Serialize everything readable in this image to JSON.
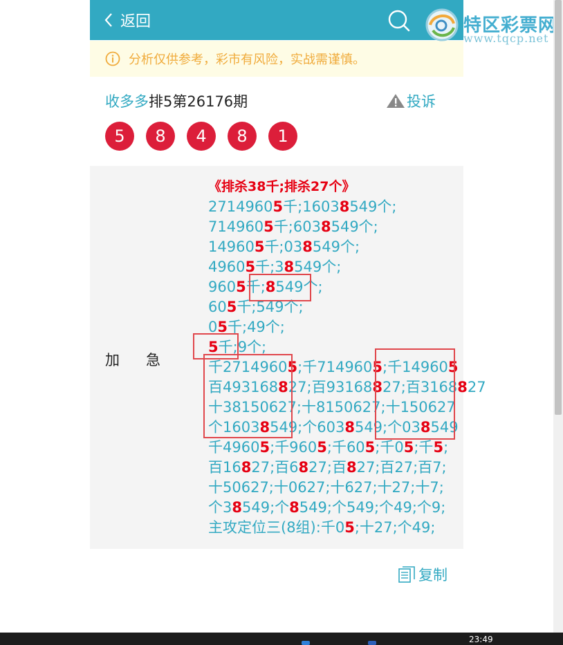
{
  "header": {
    "back_label": "返回"
  },
  "notice": {
    "text": "分析仅供参考，彩市有风险，实战需谨慎。"
  },
  "title": {
    "source": "收多多",
    "issue": "排5第26176期",
    "complain": "投诉"
  },
  "balls": [
    "5",
    "8",
    "4",
    "8",
    "1"
  ],
  "panel": {
    "label": "加急",
    "heading": "《排杀38千;排杀27个》",
    "lines": [
      [
        [
          "2714960",
          0
        ],
        [
          "5",
          1
        ],
        [
          "千;1603",
          0
        ],
        [
          "8",
          1
        ],
        [
          "549个;",
          0
        ]
      ],
      [
        [
          "714960",
          0
        ],
        [
          "5",
          1
        ],
        [
          "千;603",
          0
        ],
        [
          "8",
          1
        ],
        [
          "549个;",
          0
        ]
      ],
      [
        [
          "14960",
          0
        ],
        [
          "5",
          1
        ],
        [
          "千;03",
          0
        ],
        [
          "8",
          1
        ],
        [
          "549个;",
          0
        ]
      ],
      [
        [
          "4960",
          0
        ],
        [
          "5",
          1
        ],
        [
          "千;3",
          0
        ],
        [
          "8",
          1
        ],
        [
          "549个;",
          0
        ]
      ],
      [
        [
          "960",
          0
        ],
        [
          "5",
          1
        ],
        [
          "千;",
          0
        ],
        [
          "8",
          1
        ],
        [
          "549个;",
          0
        ]
      ],
      [
        [
          "60",
          0
        ],
        [
          "5",
          1
        ],
        [
          "千;549个;",
          0
        ]
      ],
      [
        [
          "0",
          0
        ],
        [
          "5",
          1
        ],
        [
          "千;49个;",
          0
        ]
      ],
      [
        [
          "5",
          1
        ],
        [
          "千;9个;",
          0
        ]
      ],
      [
        [
          "千2714960",
          0
        ],
        [
          "5",
          1
        ],
        [
          ";千714960",
          0
        ],
        [
          "5",
          1
        ],
        [
          ";千14960",
          0
        ],
        [
          "5",
          1
        ]
      ],
      [
        [
          "百493168",
          0
        ],
        [
          "8",
          1
        ],
        [
          "27;百93168",
          0
        ],
        [
          "8",
          1
        ],
        [
          "27;百3168",
          0
        ],
        [
          "8",
          1
        ],
        [
          "27",
          0
        ]
      ],
      [
        [
          "十38150627;十8150627;十150627",
          0
        ]
      ],
      [
        [
          "个1603",
          0
        ],
        [
          "8",
          1
        ],
        [
          "549;个603",
          0
        ],
        [
          "8",
          1
        ],
        [
          "549;个03",
          0
        ],
        [
          "8",
          1
        ],
        [
          "549",
          0
        ]
      ],
      [
        [
          "千4960",
          0
        ],
        [
          "5",
          1
        ],
        [
          ";千960",
          0
        ],
        [
          "5",
          1
        ],
        [
          ";千60",
          0
        ],
        [
          "5",
          1
        ],
        [
          ";千0",
          0
        ],
        [
          "5",
          1
        ],
        [
          ";千",
          0
        ],
        [
          "5",
          1
        ],
        [
          ";",
          0
        ]
      ],
      [
        [
          "百16",
          0
        ],
        [
          "8",
          1
        ],
        [
          "27;百6",
          0
        ],
        [
          "8",
          1
        ],
        [
          "27;百",
          0
        ],
        [
          "8",
          1
        ],
        [
          "27;百27;百7;",
          0
        ]
      ],
      [
        [
          "十50627;十0627;十627;十27;十7;",
          0
        ]
      ],
      [
        [
          "个3",
          0
        ],
        [
          "8",
          1
        ],
        [
          "549;个",
          0
        ],
        [
          "8",
          1
        ],
        [
          "549;个549;个49;个9;",
          0
        ]
      ],
      [
        [
          "主攻定位三(8组):千0",
          0
        ],
        [
          "5",
          1
        ],
        [
          ";十27;个49;",
          0
        ]
      ]
    ],
    "copy_label": "复制"
  },
  "watermark": {
    "name": "特区彩票网",
    "url": "www.tqcp.net"
  },
  "taskbar": {
    "time": "23:49"
  },
  "colors": {
    "header_bg": "#32a9c2",
    "ball": "#dc1e3a",
    "highlight": "#e60012",
    "text_teal": "#32a9c2",
    "notice_text": "#f0ab3c",
    "box": "#e0464b"
  }
}
